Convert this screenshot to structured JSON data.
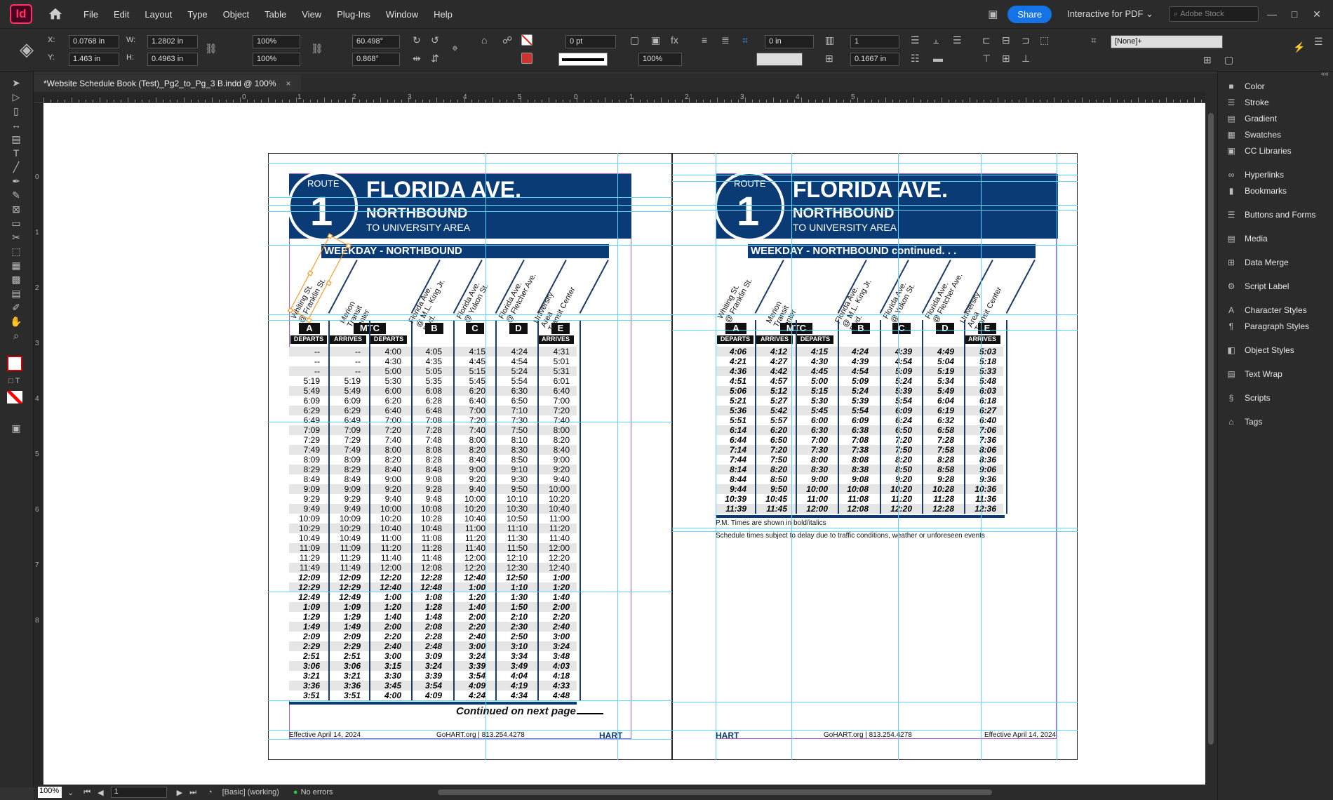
{
  "app": {
    "logo": "Id",
    "menu": [
      "File",
      "Edit",
      "Layout",
      "Type",
      "Object",
      "Table",
      "View",
      "Plug-Ins",
      "Window",
      "Help"
    ],
    "share": "Share",
    "workspace": "Interactive for PDF",
    "stock_placeholder": "Adobe Stock",
    "win_min": "—",
    "win_max": "□",
    "win_close": "✕"
  },
  "control": {
    "x_label": "X:",
    "x": "0.0768 in",
    "y_label": "Y:",
    "y": "1.463 in",
    "w_label": "W:",
    "w": "1.2802 in",
    "h_label": "H:",
    "h": "0.4963 in",
    "scale_x": "100%",
    "scale_y": "100%",
    "angle": "60.498°",
    "shear": "0.868°",
    "stroke_weight": "0 pt",
    "opacity": "100%",
    "offset": "0 in",
    "columns": "1",
    "gutter": "0.1667 in",
    "style": "[None]+"
  },
  "tab": {
    "title": "*Website Schedule Book (Test)_Pg2_to_Pg_3 B.indd @ 100%",
    "close": "×"
  },
  "ruler": {
    "h_ticks": [
      "0",
      "1",
      "2",
      "3",
      "4",
      "5",
      "0",
      "1",
      "2",
      "3",
      "4",
      "5"
    ],
    "v_ticks": [
      "0",
      "1",
      "2",
      "3",
      "4",
      "5",
      "6",
      "7",
      "8"
    ]
  },
  "status": {
    "zoom": "100%",
    "page": "1",
    "preflight_profile": "[Basic] (working)",
    "errors": "No errors"
  },
  "panels": [
    {
      "label": "Color",
      "icon": "color-icon",
      "glyph": "■"
    },
    {
      "label": "Stroke",
      "icon": "stroke-icon",
      "glyph": "☰"
    },
    {
      "label": "Gradient",
      "icon": "gradient-icon",
      "glyph": "▤"
    },
    {
      "label": "Swatches",
      "icon": "swatches-icon",
      "glyph": "▦"
    },
    {
      "label": "CC Libraries",
      "icon": "libraries-icon",
      "glyph": "▣"
    },
    {
      "label": "Hyperlinks",
      "icon": "hyperlinks-icon",
      "glyph": "∞"
    },
    {
      "label": "Bookmarks",
      "icon": "bookmarks-icon",
      "glyph": "▮"
    },
    {
      "label": "Buttons and Forms",
      "icon": "buttons-forms-icon",
      "glyph": "☰"
    },
    {
      "label": "Media",
      "icon": "media-icon",
      "glyph": "▤"
    },
    {
      "label": "Data Merge",
      "icon": "data-merge-icon",
      "glyph": "⊞"
    },
    {
      "label": "Script Label",
      "icon": "script-label-icon",
      "glyph": "⚙"
    },
    {
      "label": "Character Styles",
      "icon": "character-styles-icon",
      "glyph": "A"
    },
    {
      "label": "Paragraph Styles",
      "icon": "paragraph-styles-icon",
      "glyph": "¶"
    },
    {
      "label": "Object Styles",
      "icon": "object-styles-icon",
      "glyph": "◧"
    },
    {
      "label": "Text Wrap",
      "icon": "text-wrap-icon",
      "glyph": "▤"
    },
    {
      "label": "Scripts",
      "icon": "scripts-icon",
      "glyph": "§"
    },
    {
      "label": "Tags",
      "icon": "tags-icon",
      "glyph": "⌂"
    }
  ],
  "schedule": {
    "route_word": "ROUTE",
    "route_num": "1",
    "name": "FLORIDA AVE.",
    "direction": "NORTHBOUND",
    "dest": "TO UNIVERSITY AREA",
    "band_left": "WEEKDAY - NORTHBOUND",
    "band_right": "WEEKDAY - NORTHBOUND continued. . .",
    "stops": [
      "Whiting St.\n@ Franklin St.",
      "Marion\nTransit\nCenter",
      "Florida Ave.\n@ M.L. King Jr.\nBlvd.",
      "Florida Ave.\n@ Yukon St.",
      "Florida Ave.\n@ Fletcher Ave.",
      "University\nArea\nTransit Center"
    ],
    "timepoints": [
      "A",
      "MTC",
      "B",
      "C",
      "D",
      "E"
    ],
    "sub_labels": [
      "DEPARTS",
      "ARRIVES",
      "DEPARTS",
      "ARRIVES"
    ],
    "left_rows": [
      [
        "--",
        "--",
        "4:00",
        "4:05",
        "4:15",
        "4:24",
        "4:31"
      ],
      [
        "--",
        "--",
        "4:30",
        "4:35",
        "4:45",
        "4:54",
        "5:01"
      ],
      [
        "--",
        "--",
        "5:00",
        "5:05",
        "5:15",
        "5:24",
        "5:31"
      ],
      [
        "5:19",
        "5:19",
        "5:30",
        "5:35",
        "5:45",
        "5:54",
        "6:01"
      ],
      [
        "5:49",
        "5:49",
        "6:00",
        "6:08",
        "6:20",
        "6:30",
        "6:40"
      ],
      [
        "6:09",
        "6:09",
        "6:20",
        "6:28",
        "6:40",
        "6:50",
        "7:00"
      ],
      [
        "6:29",
        "6:29",
        "6:40",
        "6:48",
        "7:00",
        "7:10",
        "7:20"
      ],
      [
        "6:49",
        "6:49",
        "7:00",
        "7:08",
        "7:20",
        "7:30",
        "7:40"
      ],
      [
        "7:09",
        "7:09",
        "7:20",
        "7:28",
        "7:40",
        "7:50",
        "8:00"
      ],
      [
        "7:29",
        "7:29",
        "7:40",
        "7:48",
        "8:00",
        "8:10",
        "8:20"
      ],
      [
        "7:49",
        "7:49",
        "8:00",
        "8:08",
        "8:20",
        "8:30",
        "8:40"
      ],
      [
        "8:09",
        "8:09",
        "8:20",
        "8:28",
        "8:40",
        "8:50",
        "9:00"
      ],
      [
        "8:29",
        "8:29",
        "8:40",
        "8:48",
        "9:00",
        "9:10",
        "9:20"
      ],
      [
        "8:49",
        "8:49",
        "9:00",
        "9:08",
        "9:20",
        "9:30",
        "9:40"
      ],
      [
        "9:09",
        "9:09",
        "9:20",
        "9:28",
        "9:40",
        "9:50",
        "10:00"
      ],
      [
        "9:29",
        "9:29",
        "9:40",
        "9:48",
        "10:00",
        "10:10",
        "10:20"
      ],
      [
        "9:49",
        "9:49",
        "10:00",
        "10:08",
        "10:20",
        "10:30",
        "10:40"
      ],
      [
        "10:09",
        "10:09",
        "10:20",
        "10:28",
        "10:40",
        "10:50",
        "11:00"
      ],
      [
        "10:29",
        "10:29",
        "10:40",
        "10:48",
        "11:00",
        "11:10",
        "11:20"
      ],
      [
        "10:49",
        "10:49",
        "11:00",
        "11:08",
        "11:20",
        "11:30",
        "11:40"
      ],
      [
        "11:09",
        "11:09",
        "11:20",
        "11:28",
        "11:40",
        "11:50",
        "12:00"
      ],
      [
        "11:29",
        "11:29",
        "11:40",
        "11:48",
        "12:00",
        "12:10",
        "12:20"
      ],
      [
        "11:49",
        "11:49",
        "12:00",
        "12:08",
        "12:20",
        "12:30",
        "12:40"
      ],
      [
        "12:09",
        "12:09",
        "12:20",
        "12:28",
        "12:40",
        "12:50",
        "1:00"
      ],
      [
        "12:29",
        "12:29",
        "12:40",
        "12:48",
        "1:00",
        "1:10",
        "1:20"
      ],
      [
        "12:49",
        "12:49",
        "1:00",
        "1:08",
        "1:20",
        "1:30",
        "1:40"
      ],
      [
        "1:09",
        "1:09",
        "1:20",
        "1:28",
        "1:40",
        "1:50",
        "2:00"
      ],
      [
        "1:29",
        "1:29",
        "1:40",
        "1:48",
        "2:00",
        "2:10",
        "2:20"
      ],
      [
        "1:49",
        "1:49",
        "2:00",
        "2:08",
        "2:20",
        "2:30",
        "2:40"
      ],
      [
        "2:09",
        "2:09",
        "2:20",
        "2:28",
        "2:40",
        "2:50",
        "3:00"
      ],
      [
        "2:29",
        "2:29",
        "2:40",
        "2:48",
        "3:00",
        "3:10",
        "3:24"
      ],
      [
        "2:51",
        "2:51",
        "3:00",
        "3:09",
        "3:24",
        "3:34",
        "3:48"
      ],
      [
        "3:06",
        "3:06",
        "3:15",
        "3:24",
        "3:39",
        "3:49",
        "4:03"
      ],
      [
        "3:21",
        "3:21",
        "3:30",
        "3:39",
        "3:54",
        "4:04",
        "4:18"
      ],
      [
        "3:36",
        "3:36",
        "3:45",
        "3:54",
        "4:09",
        "4:19",
        "4:33"
      ],
      [
        "3:51",
        "3:51",
        "4:00",
        "4:09",
        "4:24",
        "4:34",
        "4:48"
      ]
    ],
    "right_rows": [
      [
        "4:06",
        "4:12",
        "4:15",
        "4:24",
        "4:39",
        "4:49",
        "5:03"
      ],
      [
        "4:21",
        "4:27",
        "4:30",
        "4:39",
        "4:54",
        "5:04",
        "5:18"
      ],
      [
        "4:36",
        "4:42",
        "4:45",
        "4:54",
        "5:09",
        "5:19",
        "5:33"
      ],
      [
        "4:51",
        "4:57",
        "5:00",
        "5:09",
        "5:24",
        "5:34",
        "5:48"
      ],
      [
        "5:06",
        "5:12",
        "5:15",
        "5:24",
        "5:39",
        "5:49",
        "6:03"
      ],
      [
        "5:21",
        "5:27",
        "5:30",
        "5:39",
        "5:54",
        "6:04",
        "6:18"
      ],
      [
        "5:36",
        "5:42",
        "5:45",
        "5:54",
        "6:09",
        "6:19",
        "6:27"
      ],
      [
        "5:51",
        "5:57",
        "6:00",
        "6:09",
        "6:24",
        "6:32",
        "6:40"
      ],
      [
        "6:14",
        "6:20",
        "6:30",
        "6:38",
        "6:50",
        "6:58",
        "7:06"
      ],
      [
        "6:44",
        "6:50",
        "7:00",
        "7:08",
        "7:20",
        "7:28",
        "7:36"
      ],
      [
        "7:14",
        "7:20",
        "7:30",
        "7:38",
        "7:50",
        "7:58",
        "8:06"
      ],
      [
        "7:44",
        "7:50",
        "8:00",
        "8:08",
        "8:20",
        "8:28",
        "8:36"
      ],
      [
        "8:14",
        "8:20",
        "8:30",
        "8:38",
        "8:50",
        "8:58",
        "9:06"
      ],
      [
        "8:44",
        "8:50",
        "9:00",
        "9:08",
        "9:20",
        "9:28",
        "9:36"
      ],
      [
        "9:44",
        "9:50",
        "10:00",
        "10:08",
        "10:20",
        "10:28",
        "10:36"
      ],
      [
        "10:39",
        "10:45",
        "11:00",
        "11:08",
        "11:20",
        "11:28",
        "11:36"
      ],
      [
        "11:39",
        "11:45",
        "12:00",
        "12:08",
        "12:20",
        "12:28",
        "12:36"
      ]
    ],
    "continued": "Continued on next page",
    "pm_note": "P.M. Times are shown in bold/italics",
    "delay_note": "Schedule times subject to delay due to traffic conditions, weather or unforeseen events",
    "effective": "Effective April 14, 2024",
    "contact": "GoHART.org | 813.254.4278",
    "brand": "HART"
  }
}
